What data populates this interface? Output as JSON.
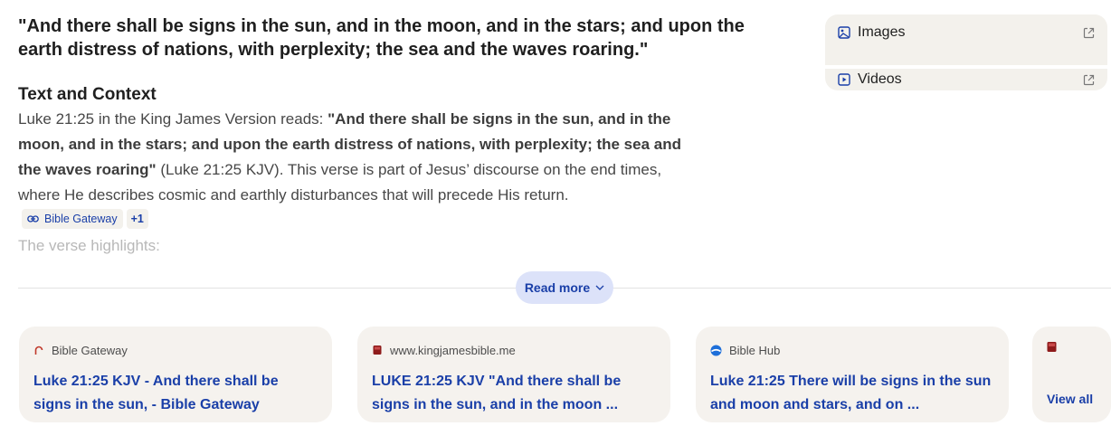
{
  "headline": "\"And there shall be signs in the sun, and in the moon, and in the stars; and upon the earth distress of nations, with perplexity; the sea and the waves roaring.\"",
  "section": {
    "title": "Text and Context",
    "intro": "Luke 21:25 in the King James Version reads: ",
    "quote": "\"And there shall be signs in the sun, and in the moon, and in the stars; and upon the earth distress of nations, with perplexity; the sea and the waves roaring\"",
    "rest": " (Luke 21:25 KJV). This verse is part of Jesus’ discourse on the end times, where He describes cosmic and earthly disturbances that will precede His return."
  },
  "source_chip": {
    "label": "Bible Gateway",
    "more": "+1"
  },
  "faded_text": "The verse highlights:",
  "read_more": "Read more",
  "side_panel": {
    "images": "Images",
    "videos": "Videos"
  },
  "cards": [
    {
      "source": "Bible Gateway",
      "title": "Luke 21:25 KJV - And there shall be signs in the sun, - Bible Gateway"
    },
    {
      "source": "www.kingjamesbible.me",
      "title": "LUKE 21:25 KJV \"And there shall be signs in the sun, and in the moon ..."
    },
    {
      "source": "Bible Hub",
      "title": "Luke 21:25 There will be signs in the sun and moon and stars, and on ..."
    }
  ],
  "view_all": "View all",
  "colors": {
    "link": "#1a3fa8",
    "chip_bg": "#f3f1ec",
    "read_more_bg": "#dce2f9"
  }
}
